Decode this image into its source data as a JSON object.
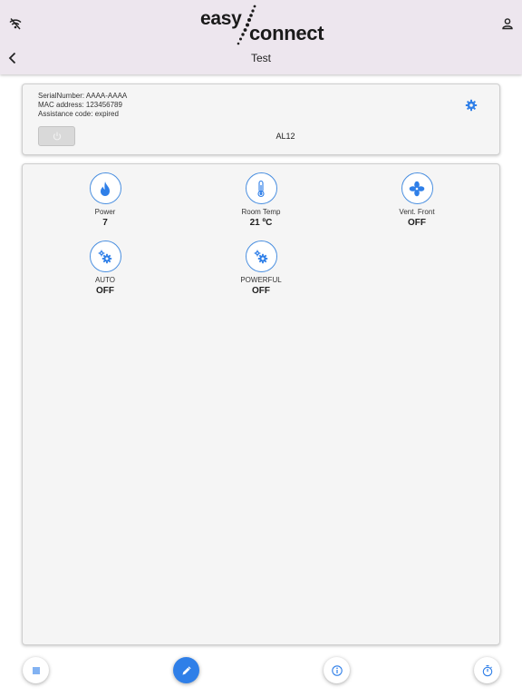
{
  "header": {
    "logo_text_1": "easy",
    "logo_text_2": "connect",
    "title": "Test",
    "icons": [
      "wifi-off-icon",
      "user-icon",
      "back-chevron-icon"
    ]
  },
  "device_info": {
    "serial": "SerialNumber: AAAA-AAAA",
    "mac": "MAC address: 123456789",
    "assistance": "Assistance code: expired",
    "model": "AL12",
    "icons": [
      "gear-icon",
      "power-icon"
    ]
  },
  "tiles": [
    {
      "label": "Power",
      "value": "7",
      "icon": "flame-icon"
    },
    {
      "label": "Room Temp",
      "value": "21 ºC",
      "icon": "thermometer-icon"
    },
    {
      "label": "Vent. Front",
      "value": "OFF",
      "icon": "fan-icon"
    },
    {
      "label": "AUTO",
      "value": "OFF",
      "icon": "gears-icon"
    },
    {
      "label": "POWERFUL",
      "value": "OFF",
      "icon": "gears-icon"
    }
  ],
  "bottom_bar": {
    "buttons": [
      "list-icon",
      "edit-icon",
      "info-icon",
      "timer-icon"
    ]
  },
  "colors": {
    "accent": "#2f7fe8",
    "header_bg": "#ede6ee",
    "card_bg": "#f5f5f5"
  }
}
